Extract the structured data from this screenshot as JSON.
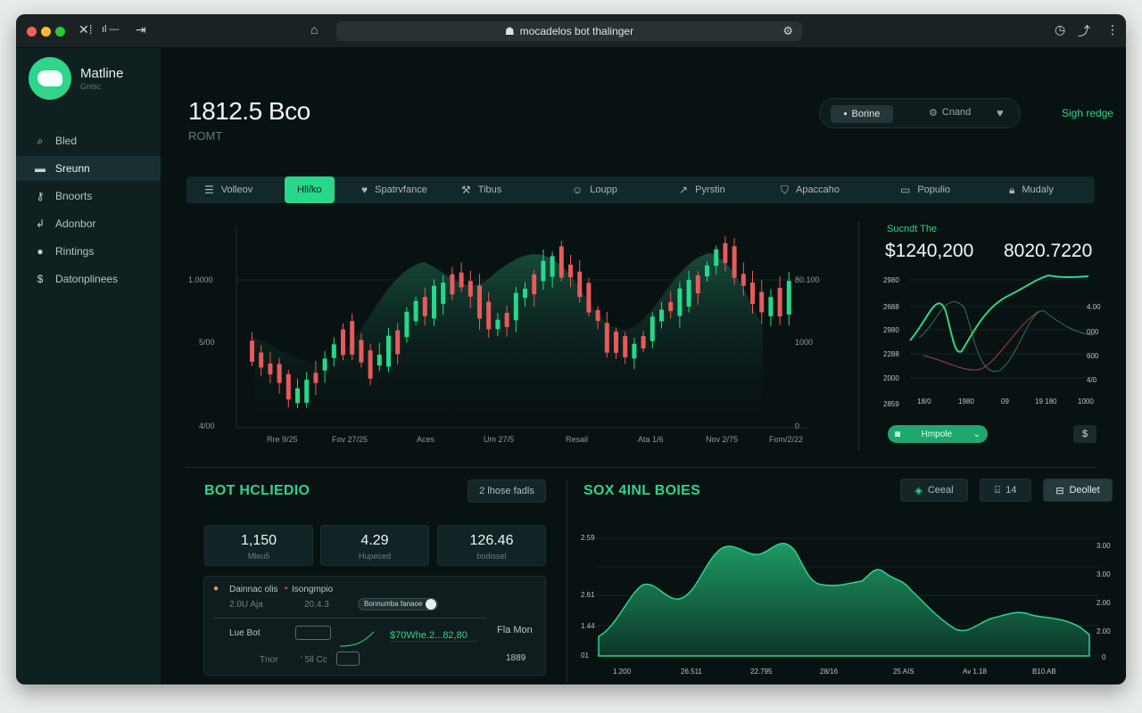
{
  "titlebar": {
    "url": "mocadelos bot thalinger",
    "colors": {
      "close": "#ff5f57",
      "min": "#febc2e",
      "max": "#28c840"
    }
  },
  "sidebar": {
    "brand": "Matline",
    "brand_sub": "Gnlsc",
    "items": [
      {
        "label": "Bled",
        "icon": "search-icon"
      },
      {
        "label": "Sreunn",
        "icon": "bag-icon"
      },
      {
        "label": "Bnoorts",
        "icon": "key-icon"
      },
      {
        "label": "Adonbor",
        "icon": "anchor-icon"
      },
      {
        "label": "Rintings",
        "icon": "gear-icon"
      },
      {
        "label": "Datonplinees",
        "icon": "coin-icon"
      }
    ]
  },
  "header": {
    "title": "1812.5 Bco",
    "subtitle": "ROMT",
    "group_button": "Borine",
    "group_text": "Cnand",
    "sign_link": "Sigh redge"
  },
  "tabs": [
    "Volleov",
    "Hll/ko",
    "Spatrvfance",
    "Tibus",
    "Loupp",
    "Pyrstin",
    "Apaccaho",
    "Populio",
    "Mudaly"
  ],
  "candle_chart": {
    "y_left": [
      "1.0000",
      "5/00",
      "4/00"
    ],
    "y_right": [
      "80.100",
      "1000",
      "0"
    ],
    "x_labels": [
      "Rre 9/25",
      "Fov 27/25",
      "Aces",
      "Um 27/5",
      "Resail",
      "Ata 1/6",
      "Nov 2/75",
      "Fom/2/22"
    ]
  },
  "mini_panel": {
    "title": "Sucndt The",
    "value_1": "$1240,200",
    "value_2": "8020.7220",
    "y_left": [
      "2980",
      "2688",
      "2980",
      "2288",
      "2000",
      "2859"
    ],
    "y_right": [
      "4.00",
      "000",
      "600",
      "4/0"
    ],
    "x_labels": [
      "18/0",
      "1980",
      "09",
      "19 180",
      "1000"
    ],
    "dropdown": "Hmpole",
    "button": "$"
  },
  "bot_panel": {
    "title": "BOT HCLIEDIO",
    "badge": "2 lhose fadls",
    "stats": [
      {
        "value": "1,150",
        "label": "Mleu5"
      },
      {
        "value": "4.29",
        "label": "Hupeced"
      },
      {
        "value": "126.46",
        "label": "bodissel"
      }
    ],
    "form": {
      "legend_1": "Dainnac olis",
      "legend_2": "Isongmpio",
      "val_1": "2.0U Aja",
      "val_2": "20.4.3",
      "toggle_label": "Bonnumba fanaoe",
      "row_label": "Lue Bot",
      "green_value": "$70Whe.2...82,80",
      "right_label": "Fla Mon",
      "bottom_label": "Tnor",
      "bottom_mid": "' 5ll Cc",
      "right_value": "1889"
    }
  },
  "sox_panel": {
    "title": "SOX 4INL BOIES",
    "btn_1": "Ceeal",
    "btn_2": "14",
    "btn_3": "Deollet",
    "y_left": [
      "2.59",
      "2.61",
      "1.44",
      "01"
    ],
    "y_right": [
      "3.00",
      "3.00",
      "2.00",
      "2.00",
      "0"
    ],
    "x_labels": [
      "1.200",
      "26.511",
      "22.795",
      "28/16",
      "25 AIS",
      "Av 1.18",
      "B10 AB"
    ]
  }
}
